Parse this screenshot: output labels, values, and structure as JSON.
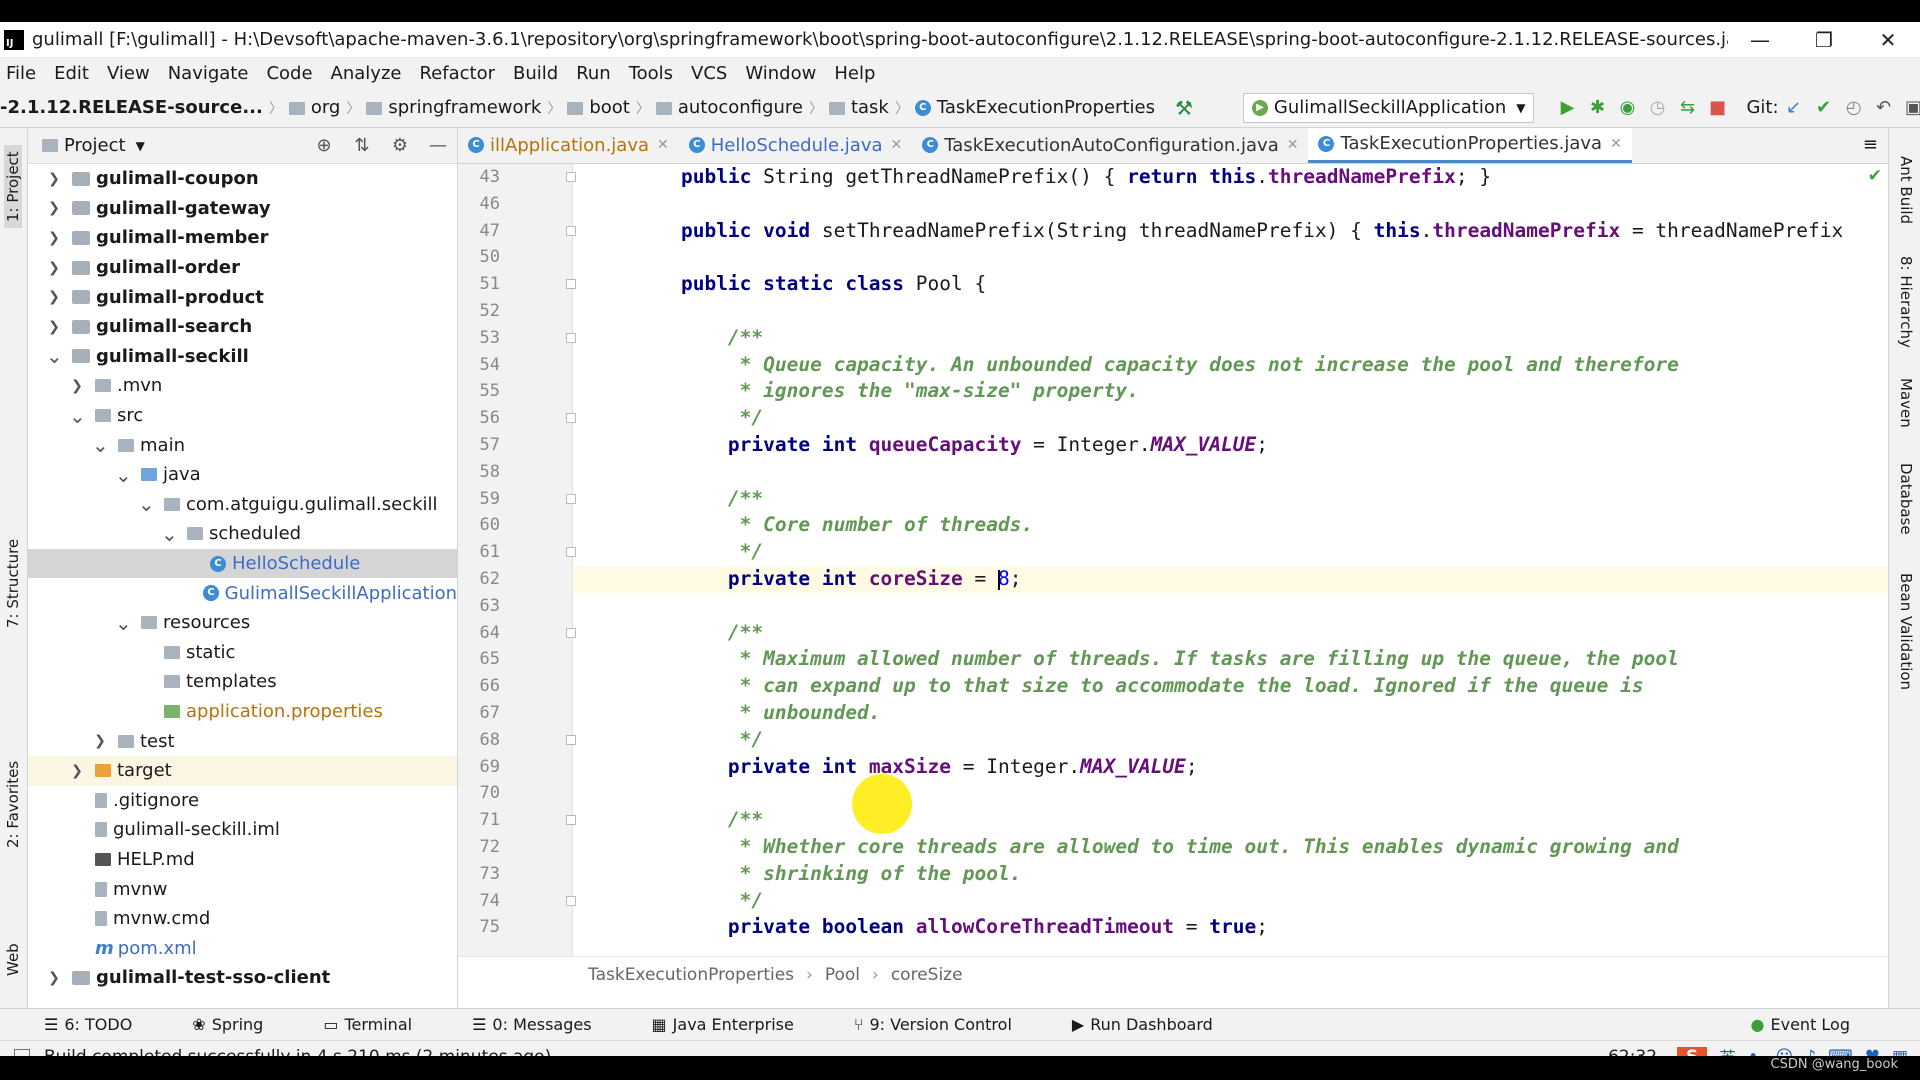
{
  "window": {
    "title": "gulimall [F:\\gulimall] - H:\\Devsoft\\apache-maven-3.6.1\\repository\\org\\springframework\\boot\\spring-boot-autoconfigure\\2.1.12.RELEASE\\spring-boot-autoconfigure-2.1.12.RELEASE-sources.jar!\\org\\springf...",
    "minimize": "—",
    "restore": "❐",
    "close": "✕"
  },
  "menu": [
    "File",
    "Edit",
    "View",
    "Navigate",
    "Code",
    "Analyze",
    "Refactor",
    "Build",
    "Run",
    "Tools",
    "VCS",
    "Window",
    "Help"
  ],
  "breadcrumb": [
    "-2.1.12.RELEASE-source...",
    "org",
    "springframework",
    "boot",
    "autoconfigure",
    "task",
    "TaskExecutionProperties"
  ],
  "run_config": "GulimallSeckillApplication",
  "git_label": "Git:",
  "project_panel": {
    "title": "Project"
  },
  "tree": [
    {
      "label": "gulimall-coupon",
      "level": 0,
      "arrow": "right",
      "bold": true,
      "icon": "module"
    },
    {
      "label": "gulimall-gateway",
      "level": 0,
      "arrow": "right",
      "bold": true,
      "icon": "module"
    },
    {
      "label": "gulimall-member",
      "level": 0,
      "arrow": "right",
      "bold": true,
      "icon": "module"
    },
    {
      "label": "gulimall-order",
      "level": 0,
      "arrow": "right",
      "bold": true,
      "icon": "module"
    },
    {
      "label": "gulimall-product",
      "level": 0,
      "arrow": "right",
      "bold": true,
      "icon": "module"
    },
    {
      "label": "gulimall-search",
      "level": 0,
      "arrow": "right",
      "bold": true,
      "icon": "module"
    },
    {
      "label": "gulimall-seckill",
      "level": 0,
      "arrow": "down",
      "bold": true,
      "icon": "module"
    },
    {
      "label": ".mvn",
      "level": 1,
      "arrow": "right",
      "icon": "folder-gray"
    },
    {
      "label": "src",
      "level": 1,
      "arrow": "down",
      "icon": "folder-gray"
    },
    {
      "label": "main",
      "level": 2,
      "arrow": "down",
      "icon": "folder-gray"
    },
    {
      "label": "java",
      "level": 3,
      "arrow": "down",
      "icon": "folder-blue"
    },
    {
      "label": "com.atguigu.gulimall.seckill",
      "level": 4,
      "arrow": "down",
      "icon": "folder-gray"
    },
    {
      "label": "scheduled",
      "level": 5,
      "arrow": "down",
      "icon": "folder-gray"
    },
    {
      "label": "HelloSchedule",
      "level": 6,
      "arrow": "",
      "icon": "class",
      "selected": true,
      "color": "blue"
    },
    {
      "label": "GulimallSeckillApplication",
      "level": 6,
      "arrow": "",
      "icon": "class-run",
      "color": "blue",
      "shift": -1
    },
    {
      "label": "resources",
      "level": 3,
      "arrow": "down",
      "icon": "folder-gray"
    },
    {
      "label": "static",
      "level": 4,
      "arrow": "",
      "icon": "folder-gray"
    },
    {
      "label": "templates",
      "level": 4,
      "arrow": "",
      "icon": "folder-gray"
    },
    {
      "label": "application.properties",
      "level": 4,
      "arrow": "",
      "icon": "props",
      "color": "orange",
      "shift": 0
    },
    {
      "label": "test",
      "level": 2,
      "arrow": "right",
      "icon": "folder-gray"
    },
    {
      "label": "target",
      "level": 1,
      "arrow": "right",
      "icon": "folder-orange",
      "highlight": true
    },
    {
      "label": ".gitignore",
      "level": 1,
      "arrow": "",
      "icon": "file"
    },
    {
      "label": "gulimall-seckill.iml",
      "level": 1,
      "arrow": "",
      "icon": "file"
    },
    {
      "label": "HELP.md",
      "level": 1,
      "arrow": "",
      "icon": "md"
    },
    {
      "label": "mvnw",
      "level": 1,
      "arrow": "",
      "icon": "file"
    },
    {
      "label": "mvnw.cmd",
      "level": 1,
      "arrow": "",
      "icon": "file"
    },
    {
      "label": "pom.xml",
      "level": 1,
      "arrow": "",
      "icon": "maven",
      "color": "blue"
    },
    {
      "label": "gulimall-test-sso-client",
      "level": 0,
      "arrow": "right",
      "bold": true,
      "icon": "module"
    }
  ],
  "tabs": [
    {
      "label": "illApplication.java",
      "color": "orange",
      "icon": "class-run"
    },
    {
      "label": "HelloSchedule.java",
      "color": "blue",
      "icon": "class"
    },
    {
      "label": "TaskExecutionAutoConfiguration.java",
      "color": "#333",
      "icon": "class"
    },
    {
      "label": "TaskExecutionProperties.java",
      "color": "#333",
      "icon": "class",
      "active": true
    }
  ],
  "code": [
    {
      "n": "43",
      "fold": true,
      "tokens": [
        [
          "    ",
          ""
        ],
        [
          "public ",
          "kw"
        ],
        [
          "String getThreadNamePrefix() { ",
          ""
        ],
        [
          "return ",
          "kw"
        ],
        [
          "this",
          "kw"
        ],
        [
          ".",
          ""
        ],
        [
          "threadNamePrefix",
          "fd"
        ],
        [
          "; }",
          ""
        ]
      ]
    },
    {
      "n": "46",
      "tokens": []
    },
    {
      "n": "47",
      "fold": true,
      "tokens": [
        [
          "    ",
          ""
        ],
        [
          "public void ",
          "kw"
        ],
        [
          "setThreadNamePrefix(String threadNamePrefix) { ",
          ""
        ],
        [
          "this",
          "kw"
        ],
        [
          ".",
          ""
        ],
        [
          "threadNamePrefix",
          "fd"
        ],
        [
          " = threadNamePrefix",
          ""
        ]
      ]
    },
    {
      "n": "50",
      "tokens": []
    },
    {
      "n": "51",
      "fold": true,
      "tokens": [
        [
          "    ",
          ""
        ],
        [
          "public static class ",
          "kw"
        ],
        [
          "Pool {",
          ""
        ]
      ]
    },
    {
      "n": "52",
      "tokens": []
    },
    {
      "n": "53",
      "fold": true,
      "tokens": [
        [
          "        ",
          ""
        ],
        [
          "/**",
          "cm"
        ]
      ]
    },
    {
      "n": "54",
      "tokens": [
        [
          "        ",
          ""
        ],
        [
          " * Queue capacity. An unbounded capacity does not increase the pool and therefore",
          "cm"
        ]
      ]
    },
    {
      "n": "55",
      "tokens": [
        [
          "        ",
          ""
        ],
        [
          " * ignores the \"max-size\" property.",
          "cm"
        ]
      ]
    },
    {
      "n": "56",
      "fold": true,
      "tokens": [
        [
          "        ",
          ""
        ],
        [
          " */",
          "cm"
        ]
      ]
    },
    {
      "n": "57",
      "tokens": [
        [
          "        ",
          ""
        ],
        [
          "private int ",
          "kw"
        ],
        [
          "queueCapacity",
          "fd"
        ],
        [
          " = Integer.",
          ""
        ],
        [
          "MAX_VALUE",
          "it"
        ],
        [
          ";",
          ""
        ]
      ]
    },
    {
      "n": "58",
      "tokens": []
    },
    {
      "n": "59",
      "fold": true,
      "tokens": [
        [
          "        ",
          ""
        ],
        [
          "/**",
          "cm"
        ]
      ]
    },
    {
      "n": "60",
      "tokens": [
        [
          "        ",
          ""
        ],
        [
          " * Core number of threads.",
          "cm"
        ]
      ]
    },
    {
      "n": "61",
      "fold": true,
      "tokens": [
        [
          "        ",
          ""
        ],
        [
          " */",
          "cm"
        ]
      ]
    },
    {
      "n": "62",
      "current": true,
      "tokens": [
        [
          "        ",
          ""
        ],
        [
          "private int ",
          "kw"
        ],
        [
          "coreSize",
          "fd"
        ],
        [
          " = ",
          ""
        ],
        [
          "|",
          ""
        ],
        [
          "8",
          "num"
        ],
        [
          ";",
          ""
        ]
      ]
    },
    {
      "n": "63",
      "tokens": []
    },
    {
      "n": "64",
      "fold": true,
      "tokens": [
        [
          "        ",
          ""
        ],
        [
          "/**",
          "cm"
        ]
      ]
    },
    {
      "n": "65",
      "tokens": [
        [
          "        ",
          ""
        ],
        [
          " * Maximum allowed number of threads. If tasks are filling up the queue, the pool",
          "cm"
        ]
      ]
    },
    {
      "n": "66",
      "tokens": [
        [
          "        ",
          ""
        ],
        [
          " * can expand up to that size to accommodate the load. Ignored if the queue is",
          "cm"
        ]
      ]
    },
    {
      "n": "67",
      "tokens": [
        [
          "        ",
          ""
        ],
        [
          " * unbounded.",
          "cm"
        ]
      ]
    },
    {
      "n": "68",
      "fold": true,
      "tokens": [
        [
          "        ",
          ""
        ],
        [
          " */",
          "cm"
        ]
      ]
    },
    {
      "n": "69",
      "tokens": [
        [
          "        ",
          ""
        ],
        [
          "private int ",
          "kw"
        ],
        [
          "maxSize",
          "fd"
        ],
        [
          " = Integer.",
          ""
        ],
        [
          "MAX_VALUE",
          "it"
        ],
        [
          ";",
          ""
        ]
      ]
    },
    {
      "n": "70",
      "tokens": []
    },
    {
      "n": "71",
      "fold": true,
      "tokens": [
        [
          "        ",
          ""
        ],
        [
          "/**",
          "cm"
        ]
      ]
    },
    {
      "n": "72",
      "tokens": [
        [
          "        ",
          ""
        ],
        [
          " * Whether core threads are allowed to time out. This enables dynamic growing and",
          "cm"
        ]
      ]
    },
    {
      "n": "73",
      "tokens": [
        [
          "        ",
          ""
        ],
        [
          " * shrinking of the pool.",
          "cm"
        ]
      ]
    },
    {
      "n": "74",
      "fold": true,
      "tokens": [
        [
          "        ",
          ""
        ],
        [
          " */",
          "cm"
        ]
      ]
    },
    {
      "n": "75",
      "tokens": [
        [
          "        ",
          ""
        ],
        [
          "private boolean ",
          "kw"
        ],
        [
          "allowCoreThreadTimeout",
          "fd"
        ],
        [
          " = ",
          ""
        ],
        [
          "true",
          "kw"
        ],
        [
          ";",
          ""
        ]
      ]
    }
  ],
  "editor_breadcrumb": [
    "TaskExecutionProperties",
    "Pool",
    "coreSize"
  ],
  "tool_windows": [
    {
      "key": "6",
      "label": "6: TODO",
      "icon": "list-icon"
    },
    {
      "label": "Spring",
      "icon": "spring-icon"
    },
    {
      "label": "Terminal",
      "icon": "terminal-icon"
    },
    {
      "label": "0: Messages",
      "icon": "messages-icon"
    },
    {
      "label": "Java Enterprise",
      "icon": "enterprise-icon"
    },
    {
      "label": "9: Version Control",
      "icon": "vcs-icon"
    },
    {
      "label": "Run Dashboard",
      "icon": "run-icon"
    }
  ],
  "event_log": "Event Log",
  "status": {
    "message": "Build completed successfully in 4 s 210 ms (2 minutes ago)",
    "position": "62:32",
    "ime_lang": "英"
  },
  "left_strip": [
    "1: Project",
    "7: Structure",
    "2: Favorites",
    "Web"
  ],
  "right_strip": [
    "Ant Build",
    "8: Hierarchy",
    "Maven",
    "Database",
    "Bean Validation"
  ],
  "watermark": "CSDN @wang_book"
}
